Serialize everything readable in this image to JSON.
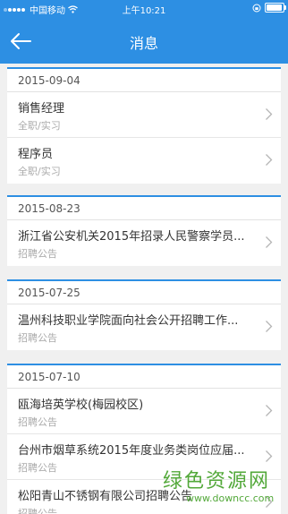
{
  "status_bar": {
    "carrier": "中国移动",
    "time": "上午10:21",
    "icons": [
      "signal-dots",
      "wifi-icon",
      "orientation-lock-icon",
      "battery-icon"
    ]
  },
  "nav": {
    "title": "消息",
    "back_icon": "back-arrow-icon"
  },
  "groups": [
    {
      "date": "2015-09-04",
      "items": [
        {
          "title": "销售经理",
          "subtitle": "全职/实习"
        },
        {
          "title": "程序员",
          "subtitle": "全职/实习"
        }
      ]
    },
    {
      "date": "2015-08-23",
      "items": [
        {
          "title": "浙江省公安机关2015年招录人民警察学员...",
          "subtitle": "招聘公告"
        }
      ]
    },
    {
      "date": "2015-07-25",
      "items": [
        {
          "title": "温州科技职业学院面向社会公开招聘工作...",
          "subtitle": "招聘公告"
        }
      ]
    },
    {
      "date": "2015-07-10",
      "items": [
        {
          "title": "瓯海培英学校(梅园校区)",
          "subtitle": "招聘公告"
        },
        {
          "title": "台州市烟草系统2015年度业务类岗位应届...",
          "subtitle": "招聘公告"
        },
        {
          "title": "松阳青山不锈钢有限公司招聘公告",
          "subtitle": "招聘公告"
        }
      ]
    }
  ],
  "watermark": {
    "text": "绿色资源网",
    "url": "www.downcc.com"
  },
  "colors": {
    "accent": "#2d8fe3",
    "background": "#f0f0f0",
    "watermark": "#52a839"
  }
}
